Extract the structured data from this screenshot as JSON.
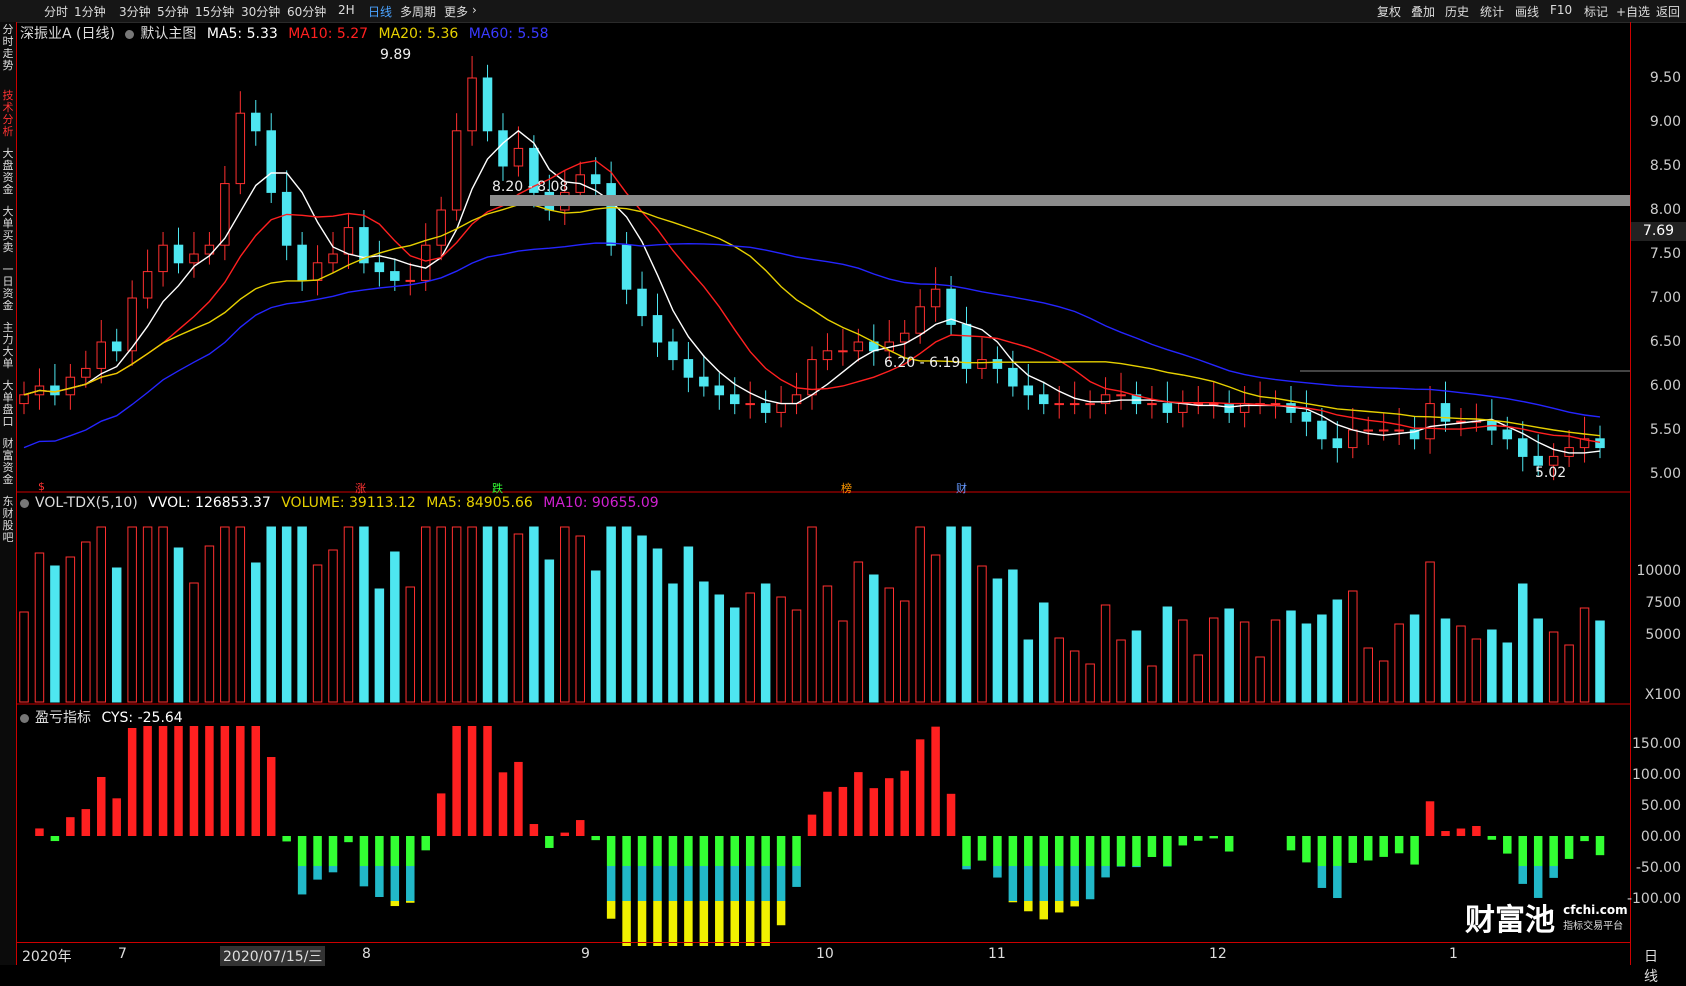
{
  "toolbar": {
    "periods": [
      "分时",
      "1分钟",
      "3分钟",
      "5分钟",
      "15分钟",
      "30分钟",
      "60分钟",
      "2H",
      "日线",
      "多周期",
      "更多"
    ],
    "active_period": "日线",
    "tools": [
      "复权",
      "叠加",
      "历史",
      "统计",
      "画线",
      "F10",
      "标记",
      "+自选",
      "返回"
    ]
  },
  "sidebar": {
    "items": [
      "分时走势",
      "技术分析",
      "大盘资金",
      "大单买卖",
      "一日资金",
      "主力大单",
      "大单盘口",
      "财富资金",
      "东财股吧"
    ],
    "active": "技术分析"
  },
  "main_legend": {
    "title": "深振业A (日线)",
    "template": "默认主图",
    "ma5": "MA5: 5.33",
    "ma10": "MA10: 5.27",
    "ma20": "MA20: 5.36",
    "ma60": "MA60: 5.58",
    "colors": {
      "ma5": "#ffffff",
      "ma10": "#ff2020",
      "ma20": "#e6d000",
      "ma60": "#2020ff"
    }
  },
  "vol_legend": {
    "name": "VOL-TDX(5,10)",
    "vvol": "VVOL: 126853.37",
    "volume": "VOLUME: 39113.12",
    "ma5": "MA5: 84905.66",
    "ma10": "MA10: 90655.09"
  },
  "cys_legend": {
    "name": "盈亏指标",
    "value": "CYS: -25.64"
  },
  "annotations": {
    "high": "9.89",
    "low": "5.02",
    "band1": "8.20 - 8.08",
    "band2": "6.20 - 6.19",
    "current_price": "7.69"
  },
  "markers": [
    "$",
    "涨",
    "跌",
    "榜",
    "财"
  ],
  "price_axis": [
    "9.50",
    "9.00",
    "8.50",
    "8.00",
    "7.50",
    "7.00",
    "6.50",
    "6.00",
    "5.50",
    "5.00"
  ],
  "vol_axis": [
    "10000",
    "7500",
    "5000",
    "X100"
  ],
  "cys_axis": [
    "150.00",
    "100.00",
    "50.00",
    "00.00",
    "-50.00",
    "-100.00"
  ],
  "date_axis": {
    "labels": [
      "2020年",
      "7",
      "2020/07/15/三",
      "8",
      "9",
      "10",
      "11",
      "12",
      "1"
    ],
    "period_label": "日线"
  },
  "logo": {
    "brand": "财富池",
    "domain": "cfchi.com",
    "tagline": "指标交易平台"
  },
  "chart_data": {
    "type": "candlestick",
    "ma_lines": [
      "MA5",
      "MA10",
      "MA20",
      "MA60"
    ],
    "price_high": 9.89,
    "price_low": 5.02,
    "closes": [
      5.9,
      6.0,
      5.9,
      6.1,
      6.2,
      6.5,
      6.4,
      7.0,
      7.3,
      7.6,
      7.4,
      7.5,
      7.6,
      8.3,
      9.1,
      8.9,
      8.2,
      7.6,
      7.2,
      7.4,
      7.5,
      7.8,
      7.4,
      7.3,
      7.2,
      7.2,
      7.6,
      8.0,
      8.9,
      9.5,
      8.9,
      8.5,
      8.7,
      8.2,
      8.0,
      8.2,
      8.4,
      8.3,
      7.6,
      7.1,
      6.8,
      6.5,
      6.3,
      6.1,
      6.0,
      5.9,
      5.8,
      5.8,
      5.7,
      5.8,
      5.9,
      6.3,
      6.4,
      6.4,
      6.5,
      6.4,
      6.5,
      6.6,
      6.9,
      7.1,
      6.7,
      6.2,
      6.3,
      6.2,
      6.0,
      5.9,
      5.8,
      5.8,
      5.8,
      5.8,
      5.9,
      5.9,
      5.8,
      5.8,
      5.7,
      5.8,
      5.8,
      5.8,
      5.7,
      5.8,
      5.8,
      5.8,
      5.7,
      5.6,
      5.4,
      5.3,
      5.5,
      5.5,
      5.5,
      5.5,
      5.4,
      5.8,
      5.6,
      5.6,
      5.6,
      5.5,
      5.4,
      5.2,
      5.1,
      5.2,
      5.3,
      5.4,
      5.3
    ]
  }
}
